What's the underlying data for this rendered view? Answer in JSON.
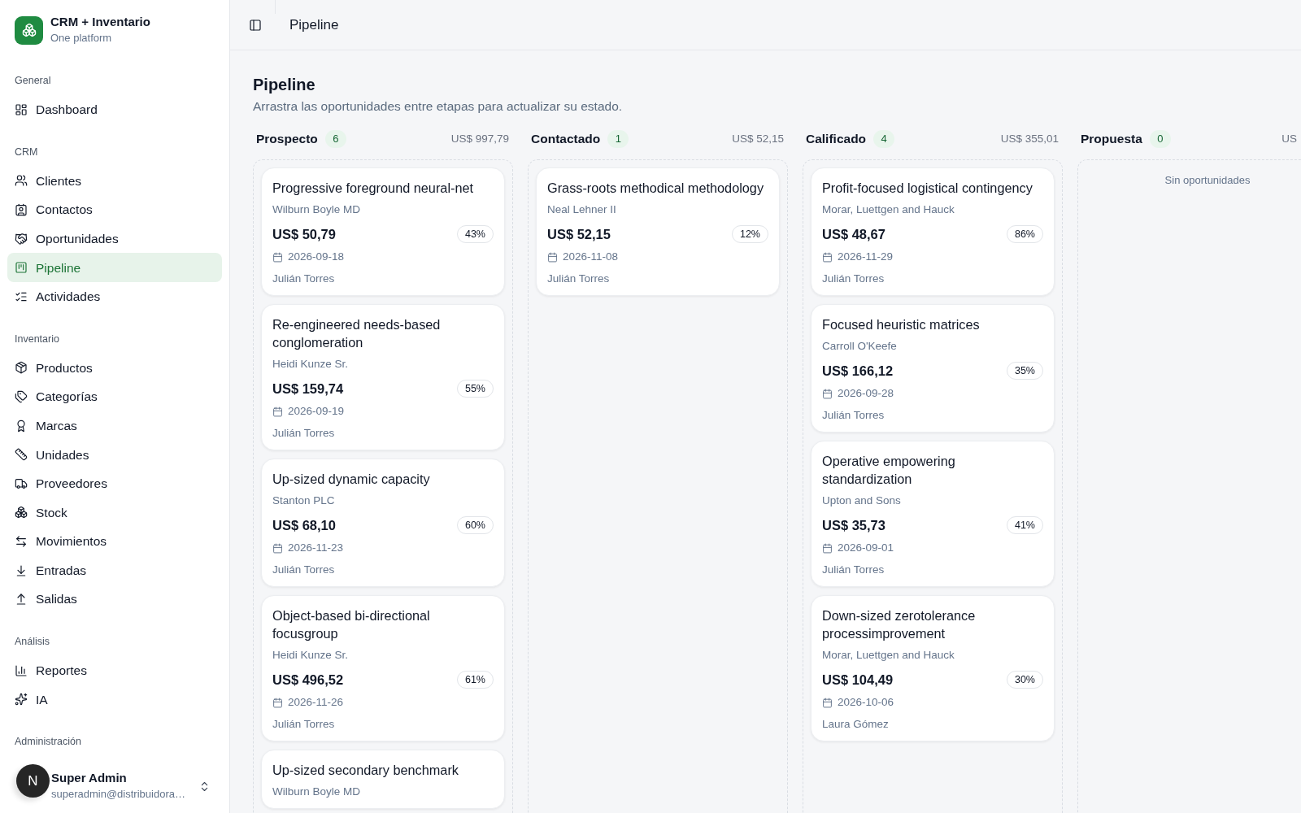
{
  "sidebar": {
    "brand": {
      "title": "CRM + Inventario",
      "subtitle": "One platform"
    },
    "sections": [
      {
        "label": "General",
        "items": [
          {
            "label": "Dashboard",
            "selected": false
          }
        ]
      },
      {
        "label": "CRM",
        "items": [
          {
            "label": "Clientes",
            "selected": false
          },
          {
            "label": "Contactos",
            "selected": false
          },
          {
            "label": "Oportunidades",
            "selected": false
          },
          {
            "label": "Pipeline",
            "selected": true
          },
          {
            "label": "Actividades",
            "selected": false
          }
        ]
      },
      {
        "label": "Inventario",
        "items": [
          {
            "label": "Productos",
            "selected": false
          },
          {
            "label": "Categorías",
            "selected": false
          },
          {
            "label": "Marcas",
            "selected": false
          },
          {
            "label": "Unidades",
            "selected": false
          },
          {
            "label": "Proveedores",
            "selected": false
          },
          {
            "label": "Stock",
            "selected": false
          },
          {
            "label": "Movimientos",
            "selected": false
          },
          {
            "label": "Entradas",
            "selected": false
          },
          {
            "label": "Salidas",
            "selected": false
          }
        ]
      },
      {
        "label": "Análisis",
        "items": [
          {
            "label": "Reportes",
            "selected": false
          },
          {
            "label": "IA",
            "selected": false
          }
        ]
      },
      {
        "label": "Administración"
      }
    ],
    "user": {
      "initial": "N",
      "name": "Super Admin",
      "email": "superadmin@distribuidora…"
    }
  },
  "header": {
    "title": "Pipeline"
  },
  "page": {
    "title": "Pipeline",
    "subtitle": "Arrastra las oportunidades entre etapas para actualizar su estado."
  },
  "columns": [
    {
      "name": "Prospecto",
      "count": "6",
      "total": "US$ 997,79",
      "cards": [
        {
          "title": "Progressive foreground neural-net",
          "company": "Wilburn Boyle MD",
          "amount": "US$ 50,79",
          "probability": "43%",
          "date": "2026-09-18",
          "owner": "Julián Torres"
        },
        {
          "title": "Re-engineered needs-based conglomeration",
          "company": "Heidi Kunze Sr.",
          "amount": "US$ 159,74",
          "probability": "55%",
          "date": "2026-09-19",
          "owner": "Julián Torres"
        },
        {
          "title": "Up-sized dynamic capacity",
          "company": "Stanton PLC",
          "amount": "US$ 68,10",
          "probability": "60%",
          "date": "2026-11-23",
          "owner": "Julián Torres"
        },
        {
          "title": "Object-based bi-directional focusgroup",
          "company": "Heidi Kunze Sr.",
          "amount": "US$ 496,52",
          "probability": "61%",
          "date": "2026-11-26",
          "owner": "Julián Torres"
        },
        {
          "title": "Up-sized secondary benchmark",
          "company": "Wilburn Boyle MD"
        }
      ]
    },
    {
      "name": "Contactado",
      "count": "1",
      "total": "US$ 52,15",
      "cards": [
        {
          "title": "Grass-roots methodical methodology",
          "company": "Neal Lehner II",
          "amount": "US$ 52,15",
          "probability": "12%",
          "date": "2026-11-08",
          "owner": "Julián Torres"
        }
      ]
    },
    {
      "name": "Calificado",
      "count": "4",
      "total": "US$ 355,01",
      "cards": [
        {
          "title": "Profit-focused logistical contingency",
          "company": "Morar, Luettgen and Hauck",
          "amount": "US$ 48,67",
          "probability": "86%",
          "date": "2026-11-29",
          "owner": "Julián Torres"
        },
        {
          "title": "Focused heuristic matrices",
          "company": "Carroll O'Keefe",
          "amount": "US$ 166,12",
          "probability": "35%",
          "date": "2026-09-28",
          "owner": "Julián Torres"
        },
        {
          "title": "Operative empowering standardization",
          "company": "Upton and Sons",
          "amount": "US$ 35,73",
          "probability": "41%",
          "date": "2026-09-01",
          "owner": "Julián Torres"
        },
        {
          "title": "Down-sized zerotolerance processimprovement",
          "company": "Morar, Luettgen and Hauck",
          "amount": "US$ 104,49",
          "probability": "30%",
          "date": "2026-10-06",
          "owner": "Laura Gómez"
        }
      ]
    },
    {
      "name": "Propuesta",
      "count": "0",
      "total": "US",
      "empty_text": "Sin oportunidades"
    }
  ]
}
